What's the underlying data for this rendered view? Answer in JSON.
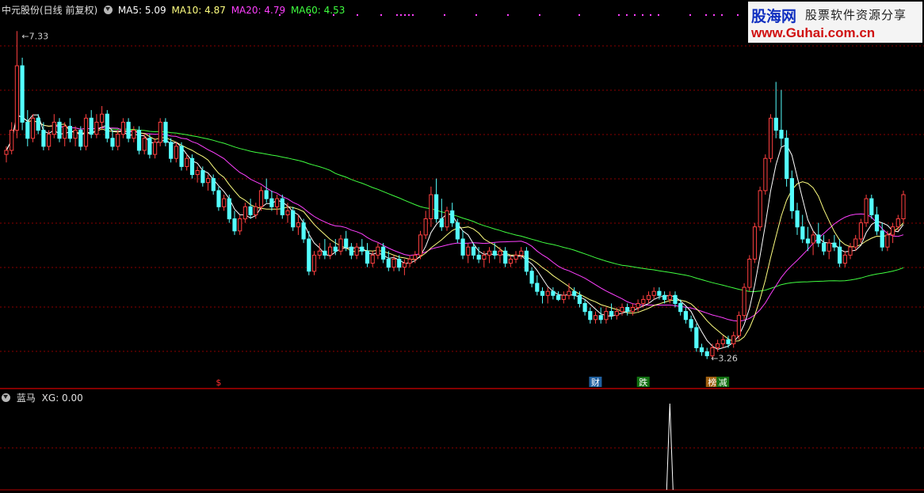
{
  "header": {
    "stock_title": "中元股份(日线 前复权)",
    "ma5": "MA5: 5.09",
    "ma10": "MA10: 4.87",
    "ma20": "MA20: 4.79",
    "ma60": "MA60: 4.53"
  },
  "sub_header": {
    "title": "蓝马",
    "xg": "XG: 0.00"
  },
  "watermark": {
    "brand": "股海网",
    "slogan": "股票软件资源分享",
    "url": "www.Guhai.com.cn"
  },
  "colors": {
    "up": "#ff4040",
    "down": "#54ffff",
    "ma5": "#ffffff",
    "ma10": "#ffff80",
    "ma20": "#ff40ff",
    "ma60": "#40ff40",
    "grid": "#8b0000"
  },
  "chart_data": [
    {
      "type": "candlestick",
      "title": "中元股份(日线 前复权)",
      "ylim": [
        3.1,
        7.5
      ],
      "annotations": [
        {
          "label": "←7.33",
          "price": 7.33
        },
        {
          "label": "←3.26",
          "price": 3.26
        }
      ],
      "event_marks": [
        "$",
        "财",
        "跌",
        "榜",
        "减"
      ],
      "series": [
        {
          "name": "MA5",
          "value": 5.09
        },
        {
          "name": "MA10",
          "value": 4.87
        },
        {
          "name": "MA20",
          "value": 4.79
        },
        {
          "name": "MA60",
          "value": 4.53
        }
      ],
      "ohlc": [
        [
          5.8,
          5.9,
          5.7,
          5.85
        ],
        [
          5.85,
          6.2,
          5.8,
          6.1
        ],
        [
          6.1,
          7.33,
          6.0,
          6.9
        ],
        [
          6.9,
          7.0,
          6.1,
          6.2
        ],
        [
          6.2,
          6.35,
          5.9,
          6.0
        ],
        [
          6.0,
          6.3,
          5.95,
          6.25
        ],
        [
          6.25,
          6.3,
          6.05,
          6.1
        ],
        [
          6.1,
          6.2,
          5.85,
          5.9
        ],
        [
          5.9,
          6.1,
          5.85,
          6.05
        ],
        [
          6.05,
          6.3,
          6.0,
          6.2
        ],
        [
          6.2,
          6.25,
          5.95,
          6.0
        ],
        [
          6.0,
          6.2,
          5.9,
          6.15
        ],
        [
          6.15,
          6.25,
          5.95,
          6.0
        ],
        [
          6.0,
          6.15,
          5.9,
          6.1
        ],
        [
          6.1,
          6.15,
          5.85,
          5.9
        ],
        [
          5.9,
          6.3,
          5.85,
          6.25
        ],
        [
          6.25,
          6.35,
          6.0,
          6.05
        ],
        [
          6.05,
          6.3,
          6.0,
          6.2
        ],
        [
          6.2,
          6.4,
          6.1,
          6.3
        ],
        [
          6.3,
          6.35,
          5.95,
          6.0
        ],
        [
          6.0,
          6.1,
          5.85,
          5.9
        ],
        [
          5.9,
          6.1,
          5.85,
          6.05
        ],
        [
          6.05,
          6.25,
          6.0,
          6.2
        ],
        [
          6.2,
          6.25,
          5.95,
          6.0
        ],
        [
          6.0,
          6.15,
          5.95,
          6.1
        ],
        [
          6.1,
          6.15,
          5.8,
          5.85
        ],
        [
          5.85,
          6.05,
          5.8,
          6.0
        ],
        [
          6.0,
          6.05,
          5.75,
          5.8
        ],
        [
          5.8,
          6.0,
          5.75,
          5.95
        ],
        [
          5.95,
          6.25,
          5.9,
          6.2
        ],
        [
          6.2,
          6.25,
          5.9,
          5.95
        ],
        [
          5.95,
          6.0,
          5.7,
          5.75
        ],
        [
          5.75,
          5.95,
          5.7,
          5.9
        ],
        [
          5.9,
          5.95,
          5.6,
          5.65
        ],
        [
          5.65,
          5.8,
          5.6,
          5.75
        ],
        [
          5.75,
          5.8,
          5.5,
          5.55
        ],
        [
          5.55,
          5.65,
          5.45,
          5.6
        ],
        [
          5.6,
          5.65,
          5.4,
          5.45
        ],
        [
          5.45,
          5.55,
          5.35,
          5.5
        ],
        [
          5.5,
          5.55,
          5.3,
          5.35
        ],
        [
          5.35,
          5.4,
          5.1,
          5.15
        ],
        [
          5.15,
          5.3,
          5.1,
          5.25
        ],
        [
          5.25,
          5.3,
          4.95,
          5.0
        ],
        [
          5.0,
          5.1,
          4.8,
          4.85
        ],
        [
          4.85,
          5.05,
          4.8,
          5.0
        ],
        [
          5.0,
          5.2,
          4.95,
          5.15
        ],
        [
          5.15,
          5.25,
          5.0,
          5.05
        ],
        [
          5.05,
          5.2,
          5.0,
          5.15
        ],
        [
          5.15,
          5.4,
          5.1,
          5.35
        ],
        [
          5.35,
          5.5,
          5.2,
          5.25
        ],
        [
          5.25,
          5.35,
          5.1,
          5.15
        ],
        [
          5.15,
          5.3,
          5.05,
          5.25
        ],
        [
          5.25,
          5.3,
          5.0,
          5.05
        ],
        [
          5.05,
          5.2,
          4.95,
          5.1
        ],
        [
          5.1,
          5.15,
          4.85,
          4.9
        ],
        [
          4.9,
          5.05,
          4.8,
          4.95
        ],
        [
          4.95,
          5.0,
          4.7,
          4.75
        ],
        [
          4.75,
          4.85,
          4.3,
          4.35
        ],
        [
          4.35,
          4.6,
          4.3,
          4.55
        ],
        [
          4.55,
          4.7,
          4.5,
          4.6
        ],
        [
          4.6,
          4.75,
          4.5,
          4.55
        ],
        [
          4.55,
          4.7,
          4.5,
          4.65
        ],
        [
          4.65,
          4.75,
          4.55,
          4.6
        ],
        [
          4.6,
          4.8,
          4.55,
          4.75
        ],
        [
          4.75,
          4.85,
          4.6,
          4.65
        ],
        [
          4.65,
          4.7,
          4.5,
          4.55
        ],
        [
          4.55,
          4.7,
          4.5,
          4.65
        ],
        [
          4.65,
          4.75,
          4.55,
          4.6
        ],
        [
          4.6,
          4.7,
          4.4,
          4.45
        ],
        [
          4.45,
          4.6,
          4.4,
          4.55
        ],
        [
          4.55,
          4.7,
          4.5,
          4.65
        ],
        [
          4.65,
          4.7,
          4.45,
          4.5
        ],
        [
          4.5,
          4.6,
          4.35,
          4.4
        ],
        [
          4.4,
          4.55,
          4.35,
          4.5
        ],
        [
          4.5,
          4.55,
          4.35,
          4.4
        ],
        [
          4.4,
          4.5,
          4.3,
          4.45
        ],
        [
          4.45,
          4.55,
          4.4,
          4.5
        ],
        [
          4.5,
          4.6,
          4.45,
          4.55
        ],
        [
          4.55,
          4.85,
          4.5,
          4.8
        ],
        [
          4.8,
          5.1,
          4.75,
          5.0
        ],
        [
          5.0,
          5.4,
          4.9,
          5.3
        ],
        [
          5.3,
          5.5,
          4.95,
          5.0
        ],
        [
          5.0,
          5.25,
          4.85,
          4.9
        ],
        [
          4.9,
          5.15,
          4.85,
          5.1
        ],
        [
          5.1,
          5.2,
          4.9,
          4.95
        ],
        [
          4.95,
          5.0,
          4.7,
          4.75
        ],
        [
          4.75,
          4.85,
          4.5,
          4.55
        ],
        [
          4.55,
          4.7,
          4.45,
          4.65
        ],
        [
          4.65,
          4.7,
          4.5,
          4.55
        ],
        [
          4.55,
          4.65,
          4.45,
          4.5
        ],
        [
          4.5,
          4.6,
          4.4,
          4.55
        ],
        [
          4.55,
          4.65,
          4.45,
          4.6
        ],
        [
          4.6,
          4.7,
          4.5,
          4.55
        ],
        [
          4.55,
          4.65,
          4.45,
          4.6
        ],
        [
          4.6,
          4.65,
          4.4,
          4.45
        ],
        [
          4.45,
          4.55,
          4.4,
          4.5
        ],
        [
          4.5,
          4.6,
          4.45,
          4.55
        ],
        [
          4.55,
          4.65,
          4.5,
          4.6
        ],
        [
          4.6,
          4.65,
          4.3,
          4.35
        ],
        [
          4.35,
          4.4,
          4.15,
          4.2
        ],
        [
          4.2,
          4.3,
          4.05,
          4.1
        ],
        [
          4.1,
          4.15,
          3.95,
          4.05
        ],
        [
          4.05,
          4.15,
          3.95,
          4.1
        ],
        [
          4.1,
          4.15,
          4.0,
          4.05
        ],
        [
          4.05,
          4.1,
          3.98,
          4.0
        ],
        [
          4.0,
          4.1,
          3.95,
          4.05
        ],
        [
          4.05,
          4.2,
          4.0,
          4.1
        ],
        [
          4.1,
          4.15,
          4.0,
          4.05
        ],
        [
          4.05,
          4.1,
          3.9,
          3.95
        ],
        [
          3.95,
          4.0,
          3.8,
          3.85
        ],
        [
          3.85,
          3.9,
          3.7,
          3.75
        ],
        [
          3.75,
          3.85,
          3.7,
          3.8
        ],
        [
          3.8,
          3.9,
          3.7,
          3.75
        ],
        [
          3.75,
          3.9,
          3.7,
          3.85
        ],
        [
          3.85,
          3.95,
          3.75,
          3.8
        ],
        [
          3.8,
          3.9,
          3.75,
          3.85
        ],
        [
          3.85,
          3.95,
          3.8,
          3.9
        ],
        [
          3.9,
          3.95,
          3.8,
          3.85
        ],
        [
          3.85,
          3.95,
          3.8,
          3.9
        ],
        [
          3.9,
          4.0,
          3.85,
          3.95
        ],
        [
          3.95,
          4.05,
          3.9,
          4.0
        ],
        [
          4.0,
          4.1,
          3.95,
          4.05
        ],
        [
          4.05,
          4.15,
          4.0,
          4.1
        ],
        [
          4.1,
          4.15,
          4.0,
          4.05
        ],
        [
          4.05,
          4.1,
          3.95,
          4.0
        ],
        [
          4.0,
          4.1,
          3.95,
          4.05
        ],
        [
          4.05,
          4.1,
          3.9,
          3.95
        ],
        [
          3.95,
          4.0,
          3.8,
          3.85
        ],
        [
          3.85,
          3.9,
          3.7,
          3.75
        ],
        [
          3.75,
          3.8,
          3.6,
          3.65
        ],
        [
          3.65,
          3.7,
          3.35,
          3.4
        ],
        [
          3.4,
          3.45,
          3.3,
          3.35
        ],
        [
          3.35,
          3.4,
          3.26,
          3.3
        ],
        [
          3.3,
          3.45,
          3.26,
          3.4
        ],
        [
          3.4,
          3.5,
          3.35,
          3.45
        ],
        [
          3.45,
          3.55,
          3.4,
          3.5
        ],
        [
          3.5,
          3.55,
          3.4,
          3.45
        ],
        [
          3.45,
          3.6,
          3.4,
          3.55
        ],
        [
          3.55,
          3.85,
          3.5,
          3.8
        ],
        [
          3.8,
          4.2,
          3.75,
          4.15
        ],
        [
          4.15,
          4.55,
          4.1,
          4.5
        ],
        [
          4.5,
          4.95,
          4.45,
          4.9
        ],
        [
          4.9,
          5.4,
          4.85,
          5.35
        ],
        [
          5.35,
          5.8,
          5.3,
          5.75
        ],
        [
          5.75,
          6.3,
          5.7,
          6.25
        ],
        [
          6.25,
          6.7,
          6.0,
          6.1
        ],
        [
          6.1,
          6.6,
          5.9,
          6.0
        ],
        [
          6.0,
          6.1,
          5.4,
          5.5
        ],
        [
          5.5,
          5.6,
          5.0,
          5.1
        ],
        [
          5.1,
          5.2,
          4.8,
          4.9
        ],
        [
          4.9,
          5.05,
          4.7,
          4.75
        ],
        [
          4.75,
          4.9,
          4.6,
          4.7
        ],
        [
          4.7,
          4.85,
          4.55,
          4.8
        ],
        [
          4.8,
          4.95,
          4.65,
          4.7
        ],
        [
          4.7,
          4.8,
          4.55,
          4.6
        ],
        [
          4.6,
          4.75,
          4.5,
          4.7
        ],
        [
          4.7,
          4.8,
          4.6,
          4.65
        ],
        [
          4.65,
          4.75,
          4.4,
          4.45
        ],
        [
          4.45,
          4.6,
          4.4,
          4.55
        ],
        [
          4.55,
          4.7,
          4.5,
          4.65
        ],
        [
          4.65,
          4.8,
          4.6,
          4.75
        ],
        [
          4.75,
          5.0,
          4.7,
          4.95
        ],
        [
          4.95,
          5.3,
          4.9,
          5.25
        ],
        [
          5.25,
          5.3,
          5.0,
          5.05
        ],
        [
          5.05,
          5.15,
          4.8,
          4.85
        ],
        [
          4.85,
          4.95,
          4.6,
          4.65
        ],
        [
          4.65,
          4.85,
          4.6,
          4.8
        ],
        [
          4.8,
          4.95,
          4.7,
          4.9
        ],
        [
          4.9,
          5.05,
          4.85,
          5.0
        ],
        [
          5.0,
          5.35,
          4.95,
          5.3
        ]
      ]
    },
    {
      "type": "line",
      "title": "蓝马",
      "series": [
        {
          "name": "XG",
          "value": 0.0
        }
      ],
      "signal_bar": {
        "index": 125,
        "value": 1
      }
    }
  ]
}
